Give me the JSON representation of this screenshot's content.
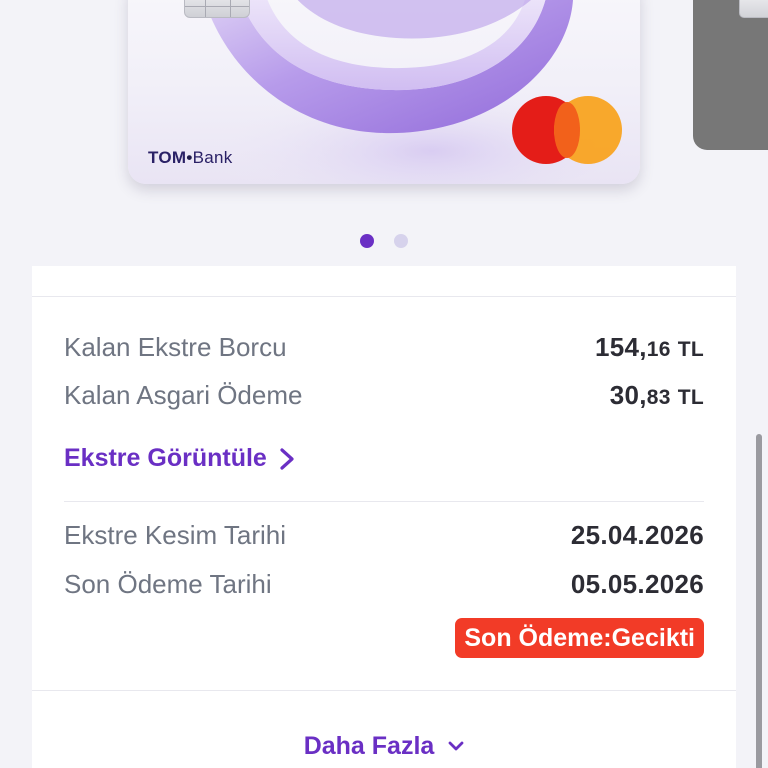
{
  "card": {
    "brand_left": "TOM",
    "brand_right": "Bank",
    "network": "mastercard-logo",
    "accent_color": "#6a2fc4"
  },
  "carousel": {
    "page_count": 2,
    "active_index": 0
  },
  "statement": {
    "remaining_debt_label": "Kalan Ekstre Borcu",
    "remaining_debt_int": "154,",
    "remaining_debt_dec": "16",
    "remaining_debt_currency": "TL",
    "min_payment_label": "Kalan Asgari Ödeme",
    "min_payment_int": "30,",
    "min_payment_dec": "83",
    "min_payment_currency": "TL",
    "view_statement_label": "Ekstre Görüntüle",
    "cutoff_date_label": "Ekstre Kesim Tarihi",
    "cutoff_date_value": "25.04.2026",
    "due_date_label": "Son Ödeme Tarihi",
    "due_date_value": "05.05.2026",
    "status_badge": "Son Ödeme:Gecikti",
    "status_color": "#f23b27"
  },
  "footer": {
    "more_label": "Daha Fazla",
    "more_icon": "chevron-down-icon"
  }
}
